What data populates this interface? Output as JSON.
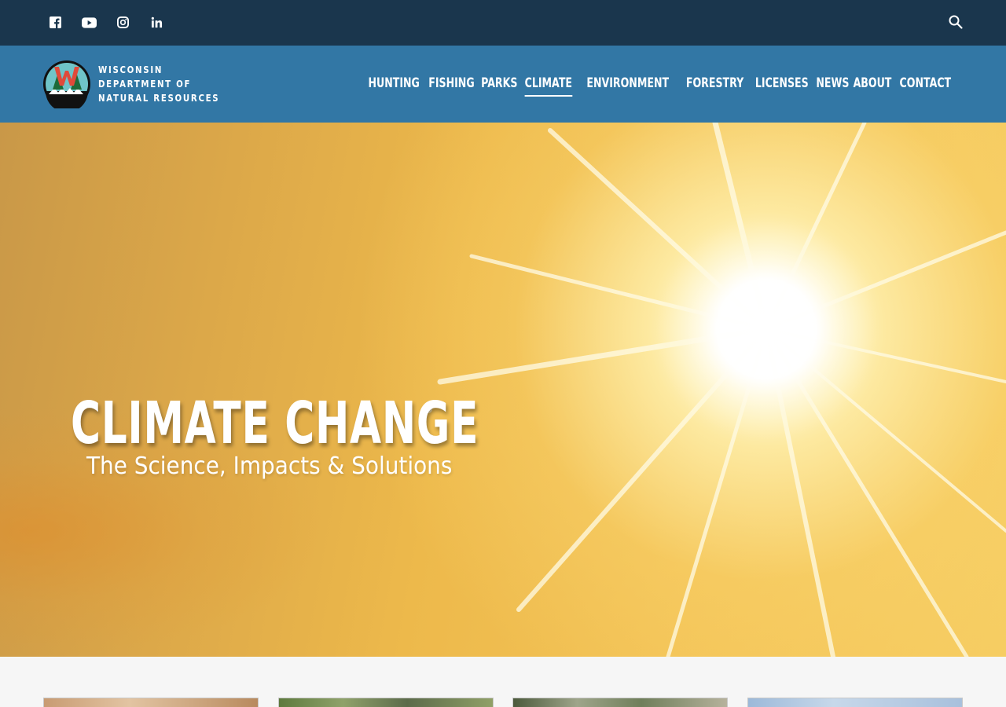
{
  "social": {
    "icons": [
      "facebook-icon",
      "youtube-icon",
      "instagram-icon",
      "linkedin-icon"
    ]
  },
  "search": {
    "icon": "search-icon"
  },
  "logo": {
    "line1": "WISCONSIN",
    "line2": "DEPARTMENT OF",
    "line3": "NATURAL RESOURCES"
  },
  "nav": {
    "items": [
      {
        "label": "HUNTING"
      },
      {
        "label": "FISHING"
      },
      {
        "label": "PARKS"
      },
      {
        "label": "CLIMATE",
        "active": true
      },
      {
        "label": "ENVIRONMENT"
      },
      {
        "label": "FORESTRY"
      },
      {
        "label": "LICENSES"
      },
      {
        "label": "NEWS"
      },
      {
        "label": "ABOUT"
      },
      {
        "label": "CONTACT"
      }
    ]
  },
  "hero": {
    "title": "CLIMATE CHANGE",
    "subtitle": "The Science, Impacts & Solutions"
  },
  "colors": {
    "topbar": "#1a364d",
    "navbar": "#3277a5",
    "hero_gold": "#f3c356"
  }
}
